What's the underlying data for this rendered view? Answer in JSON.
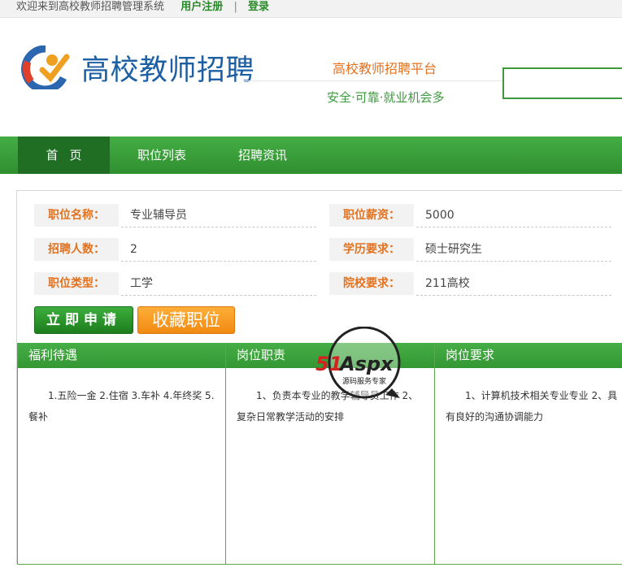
{
  "topbar": {
    "welcome": "欢迎来到高校教师招聘管理系统",
    "register": "用户注册",
    "separator": "|",
    "login": "登录"
  },
  "header": {
    "brand": "高校教师招聘",
    "slogan_main": "高校教师招聘平台",
    "slogan_sub": "安全·可靠·就业机会多",
    "search_value": ""
  },
  "nav": {
    "items": [
      {
        "label": "首页"
      },
      {
        "label": "职位列表"
      },
      {
        "label": "招聘资讯"
      }
    ]
  },
  "job": {
    "fields": [
      {
        "label": "职位名称：",
        "value": "专业辅导员"
      },
      {
        "label": "职位薪资：",
        "value": "5000"
      },
      {
        "label": "招聘人数：",
        "value": "2"
      },
      {
        "label": "学历要求：",
        "value": "硕士研究生"
      },
      {
        "label": "职位类型：",
        "value": "工学"
      },
      {
        "label": "院校要求：",
        "value": "211高校"
      }
    ],
    "apply_label": "立即申请",
    "favorite_label": "收藏职位",
    "sections": [
      {
        "title": "福利待遇",
        "content": "1.五险一金 2.住宿 3.车补 4.年终奖 5.餐补"
      },
      {
        "title": "岗位职责",
        "content": "1、负责本专业的教学辅导员工作 2、复杂日常教学活动的安排"
      },
      {
        "title": "岗位要求",
        "content": "1、计算机技术相关专业专业 2、具有良好的沟通协调能力"
      }
    ]
  },
  "watermark": {
    "brand": "51Aspx",
    "tagline": "源码服务专家"
  },
  "colors": {
    "primary_green": "#339733",
    "nav_active": "#1f6e24",
    "orange": "#e3721f",
    "brand_blue": "#1d5fa3"
  }
}
